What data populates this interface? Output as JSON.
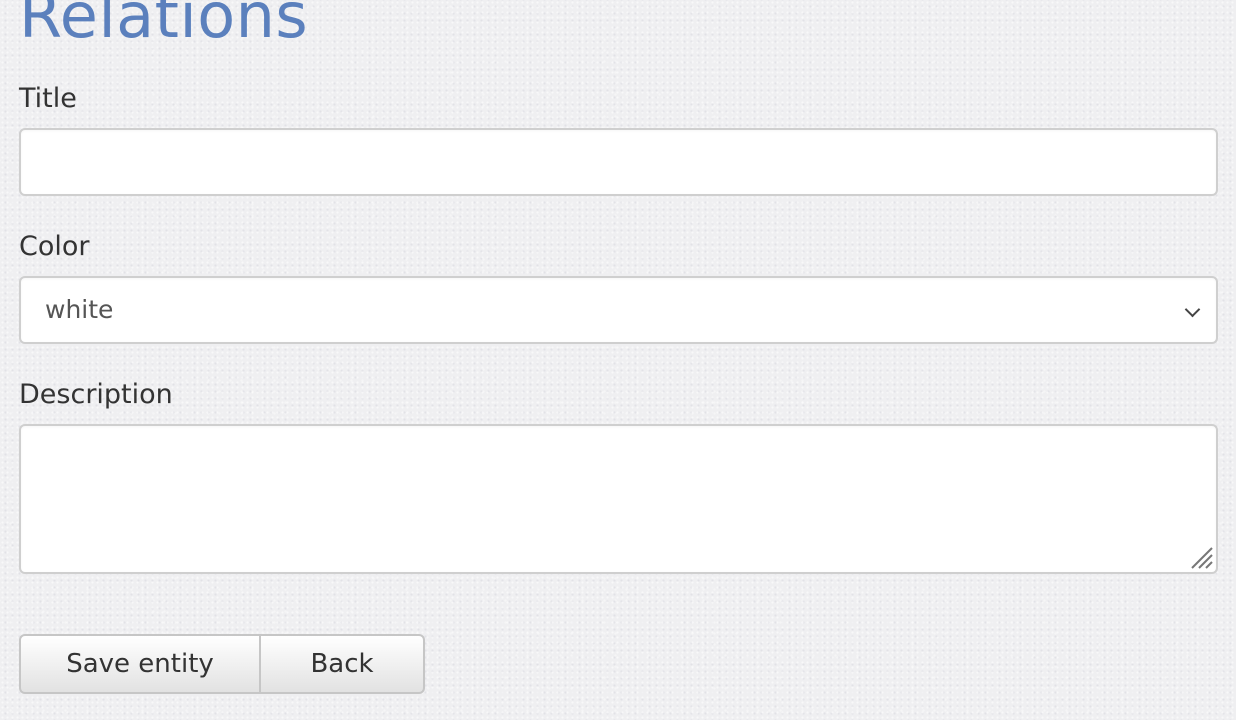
{
  "page": {
    "heading": "Relations"
  },
  "form": {
    "title": {
      "label": "Title",
      "value": "",
      "placeholder": ""
    },
    "color": {
      "label": "Color",
      "selected": "white",
      "icon": "chevron-down-icon"
    },
    "description": {
      "label": "Description",
      "value": "",
      "icon": "resize-handle-icon"
    }
  },
  "actions": {
    "save_label": "Save entity",
    "back_label": "Back"
  },
  "colors": {
    "heading": "#5b80bd",
    "text": "#333333",
    "field_border": "#cfcfcf",
    "background": "#efeff1"
  }
}
